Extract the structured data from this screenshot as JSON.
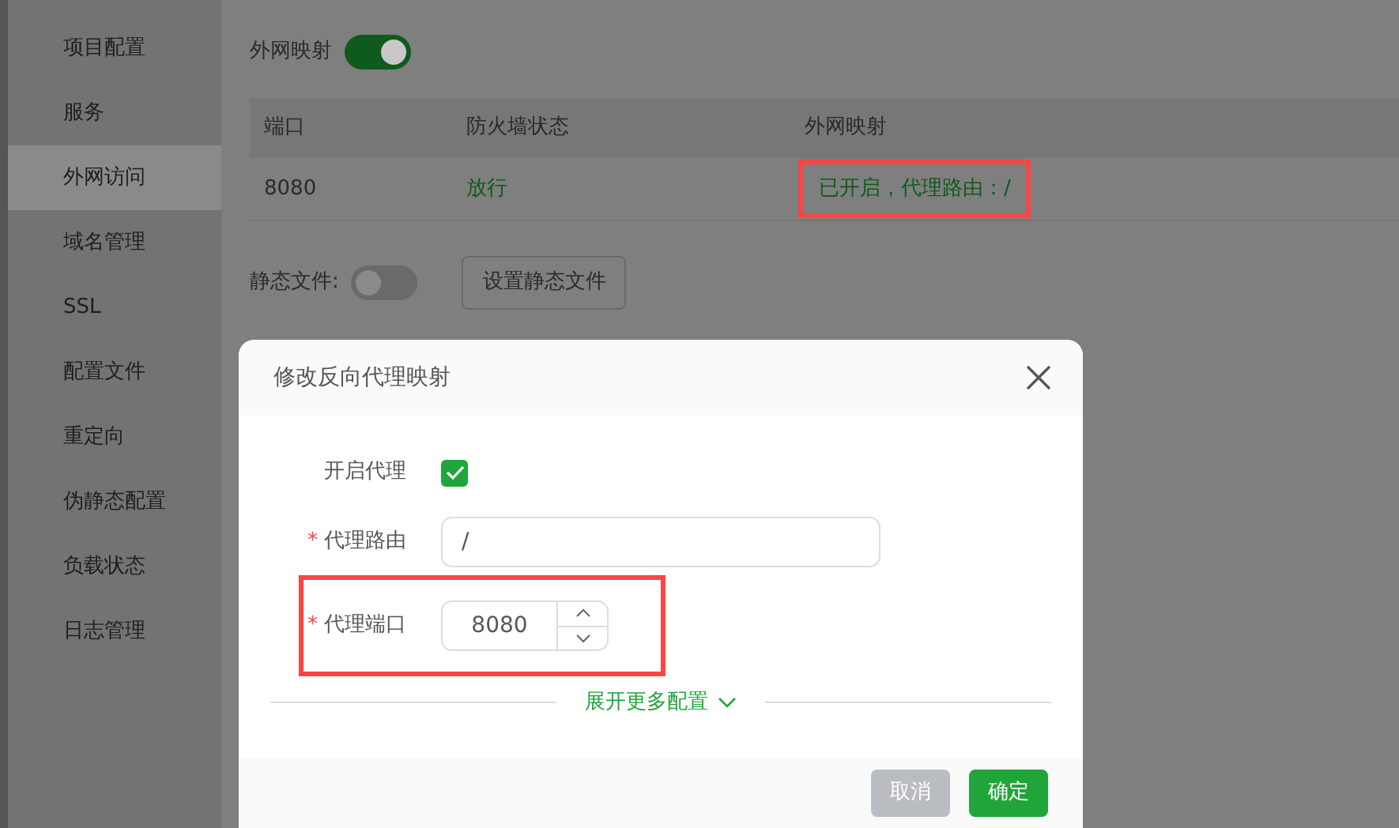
{
  "sidebar": {
    "items": [
      {
        "label": "项目配置",
        "selected": false
      },
      {
        "label": "服务",
        "selected": false
      },
      {
        "label": "外网访问",
        "selected": true
      },
      {
        "label": "域名管理",
        "selected": false
      },
      {
        "label": "SSL",
        "selected": false
      },
      {
        "label": "配置文件",
        "selected": false
      },
      {
        "label": "重定向",
        "selected": false
      },
      {
        "label": "伪静态配置",
        "selected": false
      },
      {
        "label": "负载状态",
        "selected": false
      },
      {
        "label": "日志管理",
        "selected": false
      }
    ]
  },
  "external_mapping": {
    "label": "外网映射",
    "on": true
  },
  "table": {
    "columns": [
      "端口",
      "防火墙状态",
      "外网映射"
    ],
    "rows": [
      {
        "cells": [
          {
            "text": "8080",
            "kind": "plain",
            "highlighted": false
          },
          {
            "text": "放行",
            "kind": "status",
            "highlighted": false
          },
          {
            "text": "已开启，代理路由：/",
            "kind": "status",
            "highlighted": true
          }
        ]
      }
    ]
  },
  "static_files": {
    "label": "静态文件:",
    "on": false,
    "button": "设置静态文件"
  },
  "dialog": {
    "title": "修改反向代理映射",
    "fields": [
      {
        "kind": "checkbox",
        "label": "开启代理",
        "checked": true,
        "highlighted": false
      },
      {
        "kind": "text",
        "required_mark": "*",
        "label": "代理路由",
        "value": "/",
        "highlighted": false
      },
      {
        "kind": "number",
        "required_mark": "*",
        "label": "代理端口",
        "value": "8080",
        "highlighted": true
      }
    ],
    "expand_link": "展开更多配置",
    "buttons": [
      {
        "label": "取消",
        "kind": "secondary"
      },
      {
        "label": "确定",
        "kind": "primary"
      }
    ]
  }
}
